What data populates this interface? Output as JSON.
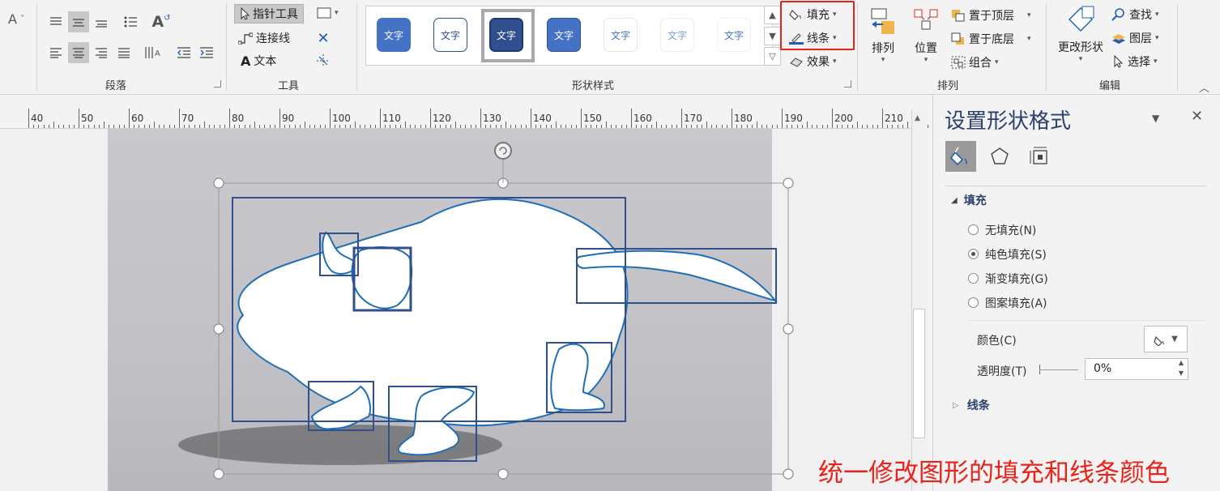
{
  "ribbon": {
    "paragraph_group": "段落",
    "tools_group": "工具",
    "tools": {
      "pointer": "指针工具",
      "connector": "连接线",
      "text": "文本"
    },
    "shape_styles_group": "形状样式",
    "style_tile_text": "文字",
    "fill": "填充",
    "line": "线条",
    "effects": "效果",
    "arrange_group": "排列",
    "arrange": {
      "arrange": "排列",
      "position": "位置",
      "bring_front": "置于顶层",
      "send_back": "置于底层",
      "group": "组合"
    },
    "edit_group": "编辑",
    "edit": {
      "change_shape": "更改形状",
      "find": "查找",
      "layers": "图层",
      "select": "选择"
    }
  },
  "ruler": {
    "labels": [
      "40",
      "50",
      "60",
      "70",
      "80",
      "90",
      "100",
      "110",
      "120",
      "130",
      "140",
      "150",
      "160",
      "170",
      "180",
      "190",
      "200",
      "210"
    ]
  },
  "pane": {
    "title": "设置形状格式",
    "fill_section": "填充",
    "options": [
      "无填充(N)",
      "纯色填充(S)",
      "渐变填充(G)",
      "图案填充(A)"
    ],
    "selected_option": "纯色填充(S)",
    "color_label": "颜色(C)",
    "transparency_label": "透明度(T)",
    "transparency_value": "0%",
    "line_section": "线条"
  },
  "caption": "统一修改图形的填充和线条颜色",
  "colors": {
    "accent_blue": "#4472c4",
    "dark_blue": "#2f4f8f",
    "highlight_red": "#e8231c",
    "shape_outline": "#1f6fb5"
  }
}
